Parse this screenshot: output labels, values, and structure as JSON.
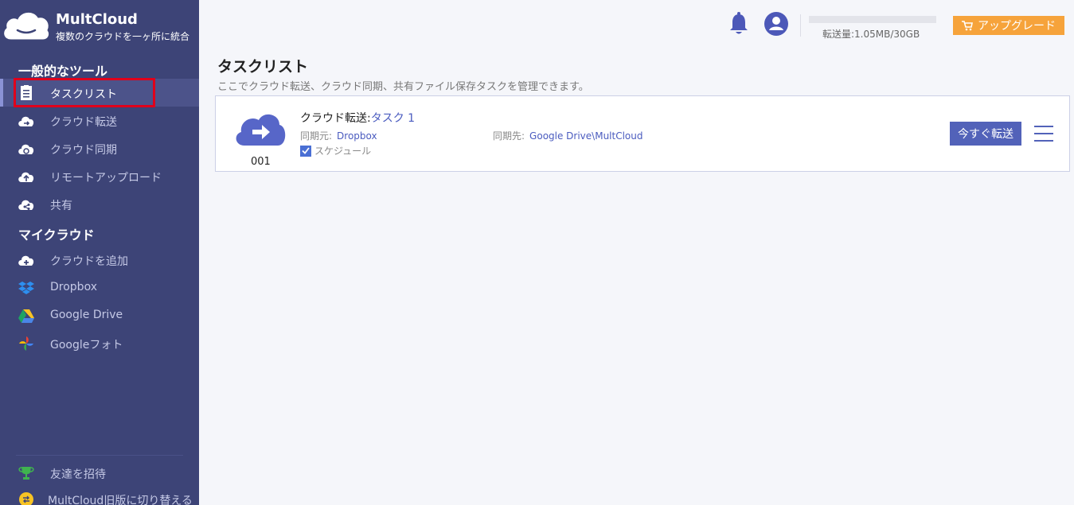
{
  "brand": {
    "title": "MultCloud",
    "subtitle": "複数のクラウドを一ヶ所に統合"
  },
  "sidebar": {
    "general_title": "一般的なツール",
    "general_items": [
      {
        "label": "タスクリスト",
        "icon": "clipboard-icon"
      },
      {
        "label": "クラウド転送",
        "icon": "cloud-transfer-icon"
      },
      {
        "label": "クラウド同期",
        "icon": "cloud-sync-icon"
      },
      {
        "label": "リモートアップロード",
        "icon": "cloud-upload-icon"
      },
      {
        "label": "共有",
        "icon": "cloud-share-icon"
      }
    ],
    "cloud_title": "マイクラウド",
    "cloud_items": [
      {
        "label": "クラウドを追加",
        "icon": "cloud-add-icon"
      },
      {
        "label": "Dropbox",
        "icon": "dropbox-icon"
      },
      {
        "label": "Google Drive",
        "icon": "google-drive-icon"
      },
      {
        "label": "Googleフォト",
        "icon": "google-photos-icon"
      }
    ],
    "bottom_items": [
      {
        "label": "友達を招待",
        "icon": "trophy-icon"
      },
      {
        "label": "MultCloud旧版に切り替える",
        "icon": "switch-version-icon"
      }
    ]
  },
  "topbar": {
    "quota_text": "転送量:1.05MB/30GB",
    "upgrade_label": "アップグレード"
  },
  "main": {
    "title": "タスクリスト",
    "description": "ここでクラウド転送、クラウド同期、共有ファイル保存タスクを管理できます。",
    "task": {
      "number": "001",
      "type_prefix": "クラウド転送:",
      "name": "タスク 1",
      "source_label": "同期元:",
      "source": "Dropbox",
      "dest_label": "同期先:",
      "dest": "Google Drive\\MultCloud",
      "schedule_label": "スケジュール",
      "run_label": "今すぐ転送"
    }
  },
  "colors": {
    "sidebar_bg": "#3d4477",
    "accent": "#5262b9",
    "upgrade": "#f6a33b",
    "highlight": "#e0001b"
  }
}
